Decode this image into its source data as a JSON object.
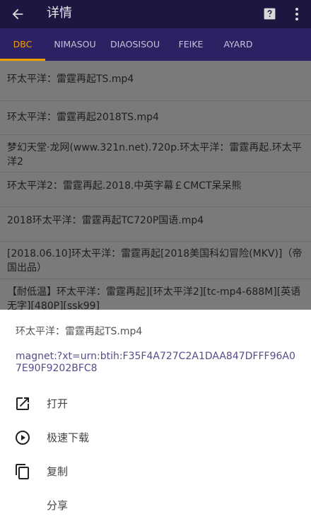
{
  "appbar": {
    "title": "详情"
  },
  "tabs": [
    {
      "label": "DBC",
      "active": true
    },
    {
      "label": "NIMASOU",
      "active": false
    },
    {
      "label": "DIAOSISOU",
      "active": false
    },
    {
      "label": "FEIKE",
      "active": false
    },
    {
      "label": "AYARD",
      "active": false
    }
  ],
  "results": [
    "环太平洋：雷霆再起TS.mp4",
    "环太平洋：雷霆再起2018TS.mp4",
    "梦幻天堂·龙网(www.321n.net).720p.环太平洋：雷霆再起.环太平洋2",
    "环太平洋2：雷霆再起.2018.中英字幕￡CMCT呆呆熊",
    "2018环太平洋：雷霆再起TC720P国语.mp4",
    "[2018.06.10]环太平洋：雷霆再起[2018美国科幻冒险(MKV)]（帝国出品）",
    "【耐低温】环太平洋：雷霆再起][环太平洋2][tc-mp4-688M][英语无字][480P][ssk99]"
  ],
  "sheet": {
    "file_name": "环太平洋：雷霆再起TS.mp4",
    "magnet": "magnet:?xt=urn:btih:F35F4A727C2A1DAA847DFFF96A07E90F9202BFC8",
    "actions": [
      {
        "label": "打开",
        "icon": "open-in-new-icon"
      },
      {
        "label": "极速下载",
        "icon": "play-circle-icon"
      },
      {
        "label": "复制",
        "icon": "copy-icon"
      },
      {
        "label": "分享",
        "icon": "share-icon"
      }
    ]
  },
  "colors": {
    "appbar": "#1d1641",
    "tabbar": "#2d2164",
    "active_tab": "#f0a000",
    "magnet_text": "#5b4a8a"
  }
}
